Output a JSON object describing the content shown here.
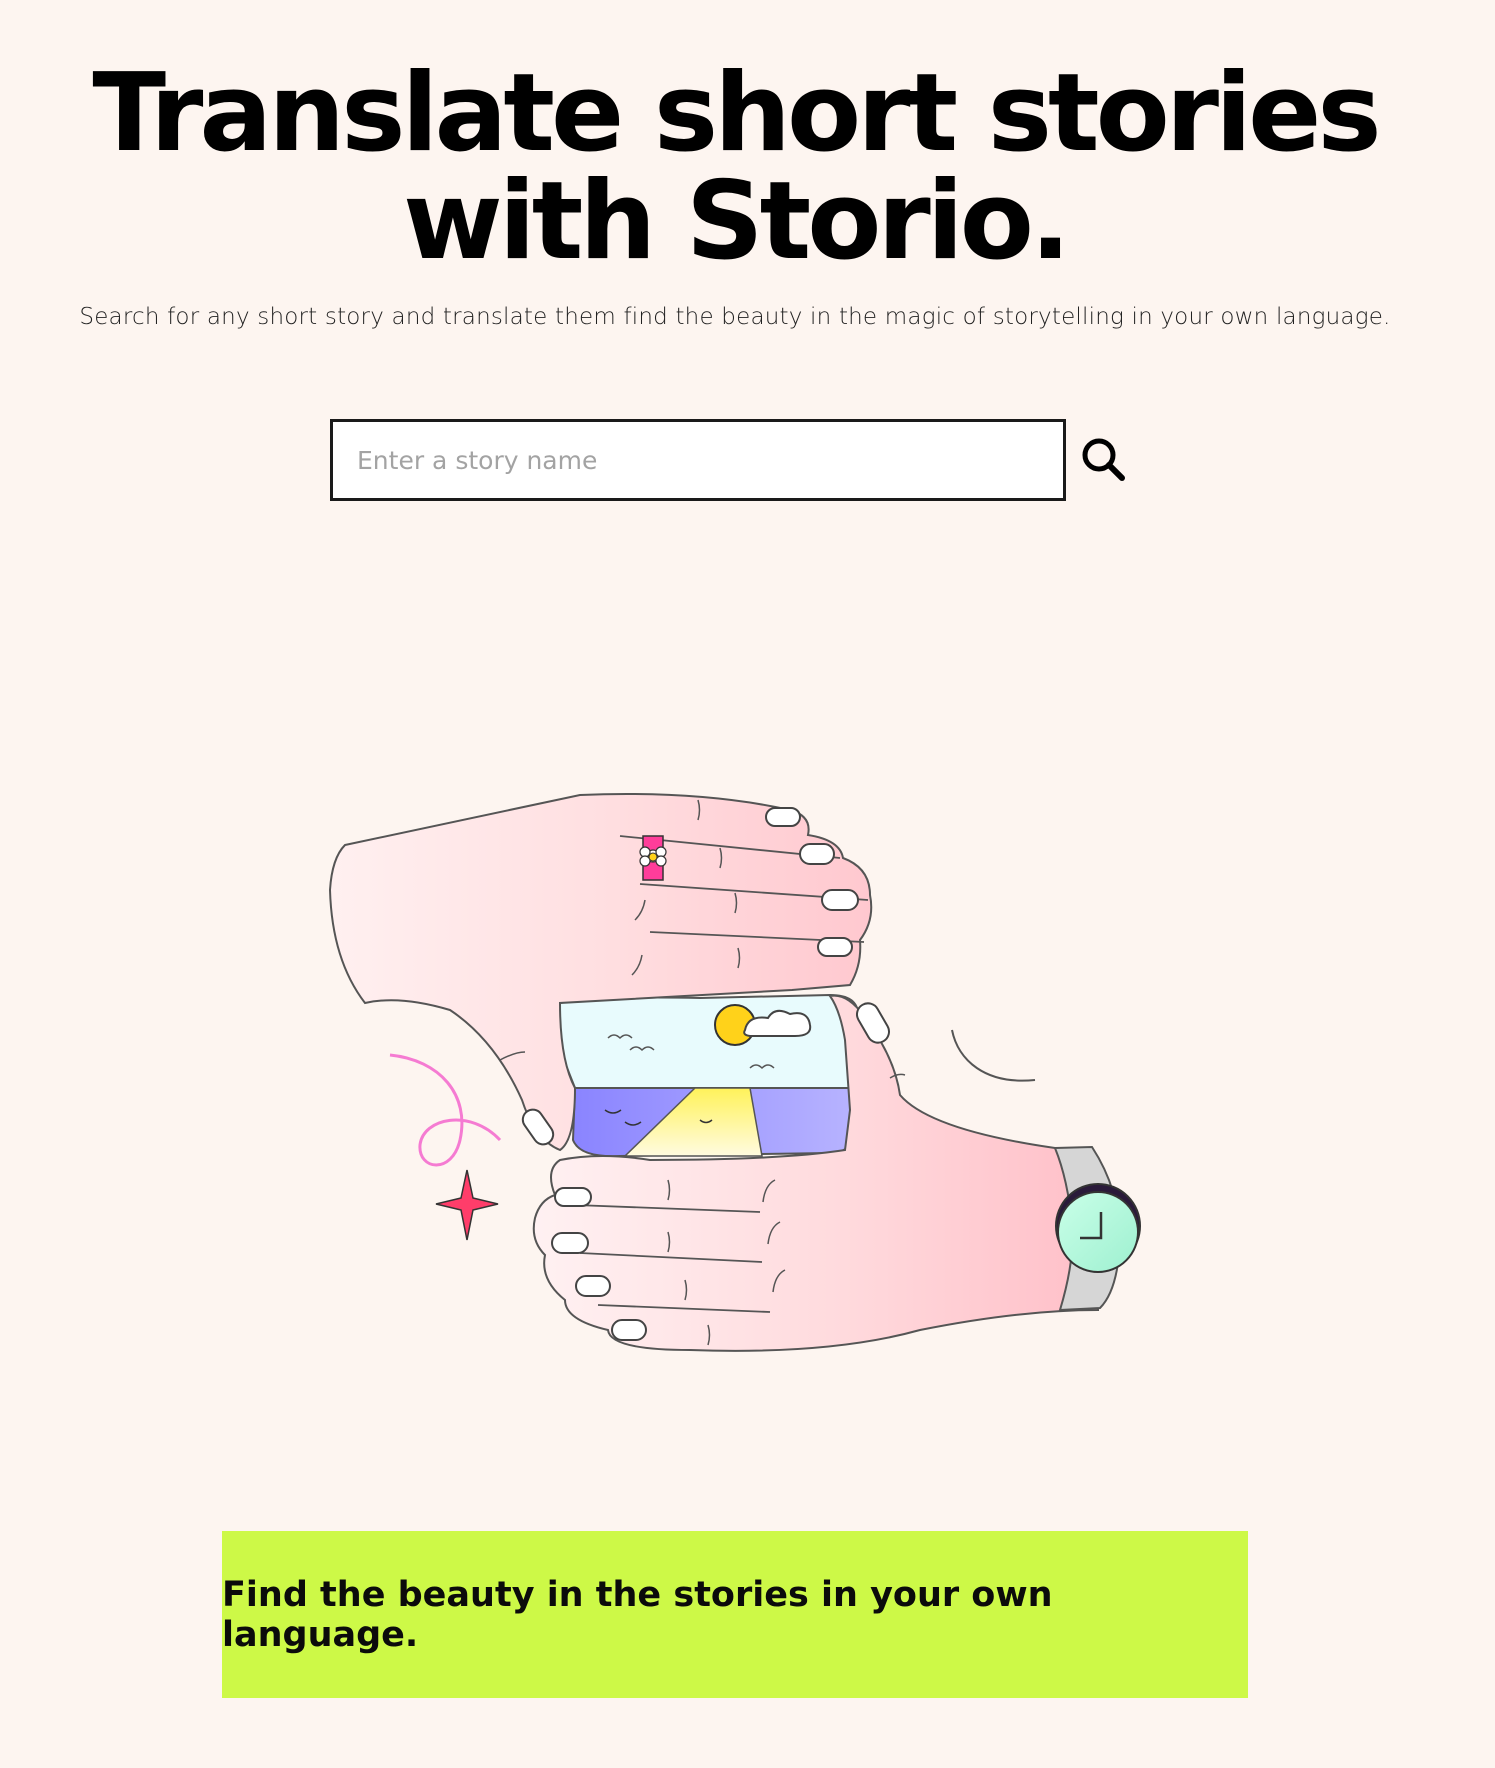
{
  "hero": {
    "title_line1": "Translate short stories",
    "title_line2": "with Storio.",
    "subtitle": "Search for any short story and translate them find the beauty in the magic of storytelling in your own language."
  },
  "search": {
    "placeholder": "Enter a story name",
    "value": "",
    "icon": "search-icon"
  },
  "illustration": {
    "subject": "two-hands-framing-landscape"
  },
  "banner": {
    "text": "Find the beauty in the stories in your own language.",
    "color": "#cdf947"
  },
  "colors": {
    "background": "#fdf5f0",
    "accent": "#cdf947"
  }
}
